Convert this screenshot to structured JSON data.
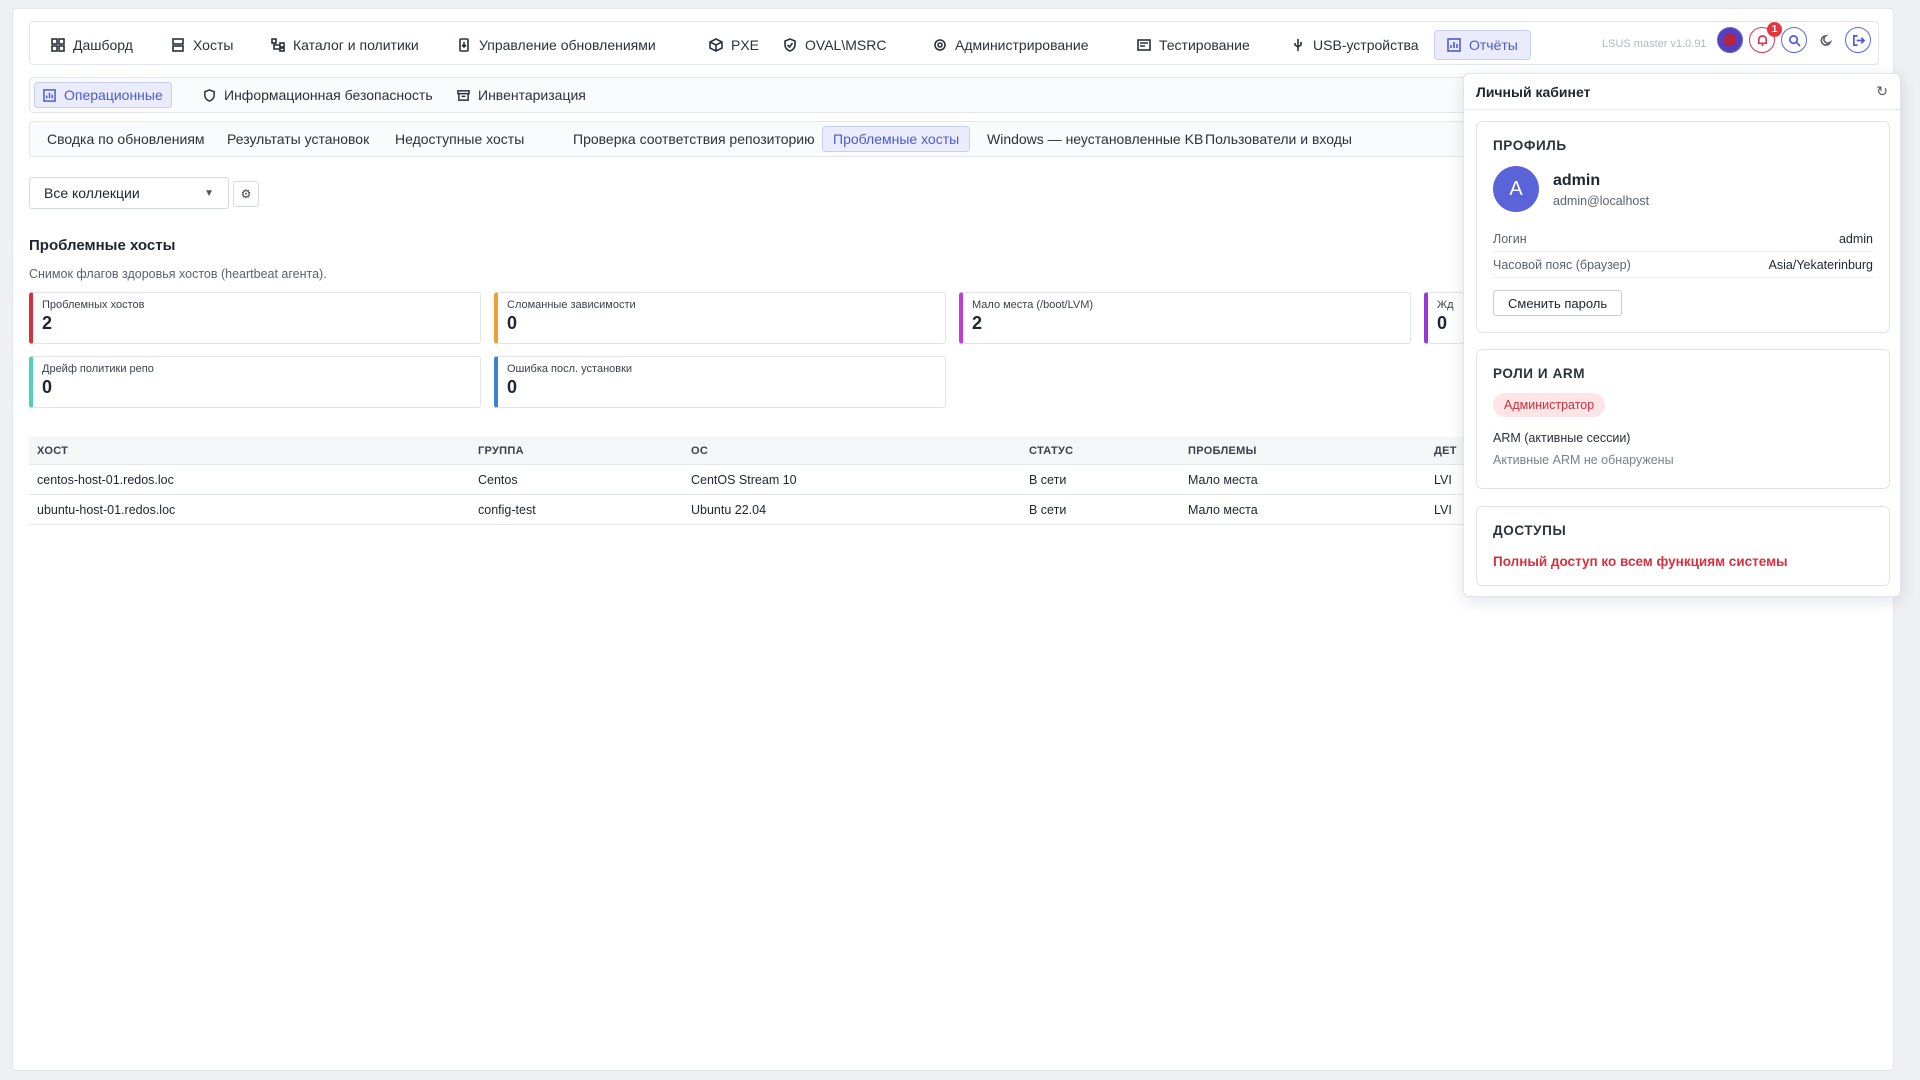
{
  "nav": {
    "items": [
      {
        "label": "Дашборд",
        "icon": "dashboard-icon"
      },
      {
        "label": "Хосты",
        "icon": "server-icon"
      },
      {
        "label": "Каталог и политики",
        "icon": "tree-icon"
      },
      {
        "label": "Управление обновлениями",
        "icon": "update-icon"
      },
      {
        "label": "PXE",
        "icon": "box-icon"
      },
      {
        "label": "OVAL\\MSRC",
        "icon": "shield-check-icon"
      },
      {
        "label": "Администрирование",
        "icon": "admin-gear-icon"
      },
      {
        "label": "Тестирование",
        "icon": "test-icon"
      },
      {
        "label": "USB-устройства",
        "icon": "usb-icon"
      },
      {
        "label": "Отчёты",
        "icon": "report-icon"
      }
    ],
    "active_index": 9,
    "version": "LSUS master v1.0.91",
    "notifications_count": "1"
  },
  "subnav": {
    "items": [
      {
        "label": "Операционные",
        "icon": "report-icon"
      },
      {
        "label": "Информационная безопасность",
        "icon": "shield-icon"
      },
      {
        "label": "Инвентаризация",
        "icon": "archive-icon"
      }
    ],
    "active_index": 0
  },
  "reports": {
    "items": [
      "Сводка по обновлениям",
      "Результаты установок",
      "Недоступные хосты",
      "Проверка соответствия репозиторию",
      "Проблемные хосты",
      "Windows — неустановленные KB",
      "Пользователи и входы"
    ],
    "active_index": 4
  },
  "filter": {
    "collection": "Все коллекции",
    "settings_glyph": "⚙"
  },
  "page": {
    "title": "Проблемные хосты",
    "subtitle": "Снимок флагов здоровья хостов (heartbeat агента).",
    "cards": [
      {
        "label": "Проблемных хостов",
        "value": "2",
        "color": "#d6303f"
      },
      {
        "label": "Сломанные зависимости",
        "value": "0",
        "color": "#f0a030"
      },
      {
        "label": "Мало места (/boot/LVM)",
        "value": "2",
        "color": "#c23bd4"
      },
      {
        "label": "Жд",
        "value": "0",
        "color": "#9b36d9"
      },
      {
        "label": "Дрейф политики репо",
        "value": "0",
        "color": "#4fd1b8"
      },
      {
        "label": "Ошибка посл. установки",
        "value": "0",
        "color": "#3b82d6"
      }
    ]
  },
  "table": {
    "headers": [
      "ХОСТ",
      "ГРУППА",
      "ОС",
      "СТАТУС",
      "ПРОБЛЕМЫ",
      "ДЕТ"
    ],
    "rows": [
      [
        "centos-host-01.redos.loc",
        "Centos",
        "CentOS Stream 10",
        "В сети",
        "Мало места",
        "LVI"
      ],
      [
        "ubuntu-host-01.redos.loc",
        "config-test",
        "Ubuntu 22.04",
        "В сети",
        "Мало места",
        "LVI"
      ]
    ]
  },
  "cabinet": {
    "title": "Личный кабинет",
    "refresh_glyph": "↻",
    "profile_title": "ПРОФИЛЬ",
    "avatar_letter": "A",
    "username": "admin",
    "email": "admin@localhost",
    "login_label": "Логин",
    "login_value": "admin",
    "tz_label": "Часовой пояс (браузер)",
    "tz_value": "Asia/Yekaterinburg",
    "change_password": "Сменить пароль",
    "roles_title": "РОЛИ И ARM",
    "role": "Администратор",
    "arm_title": "ARM (активные сессии)",
    "arm_none": "Активные ARM не обнаружены",
    "access_title": "ДОСТУПЫ",
    "access_text": "Полный доступ ко всем функциям системы"
  }
}
